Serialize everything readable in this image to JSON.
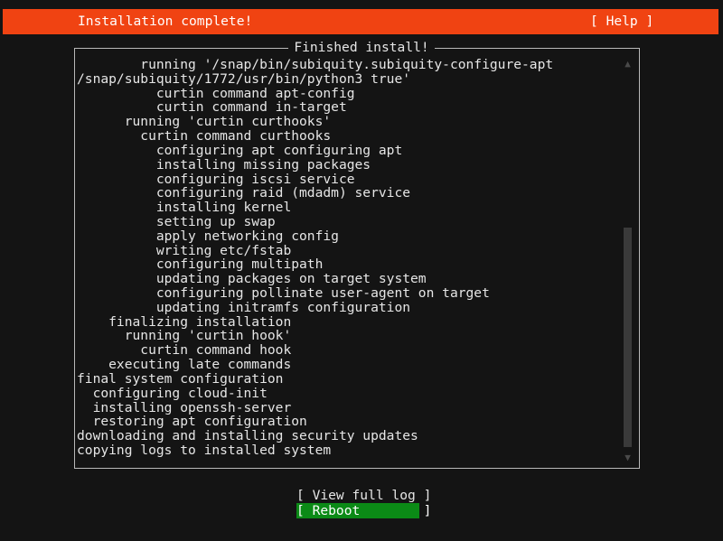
{
  "header": {
    "title": "Installation complete!",
    "help_label": "[ Help ]",
    "accent_color": "#f04312"
  },
  "panel": {
    "frame_title": "Finished install!",
    "log_lines": [
      "        running '/snap/bin/subiquity.subiquity-configure-apt",
      "/snap/subiquity/1772/usr/bin/python3 true'",
      "          curtin command apt-config",
      "          curtin command in-target",
      "      running 'curtin curthooks'",
      "        curtin command curthooks",
      "          configuring apt configuring apt",
      "          installing missing packages",
      "          configuring iscsi service",
      "          configuring raid (mdadm) service",
      "          installing kernel",
      "          setting up swap",
      "          apply networking config",
      "          writing etc/fstab",
      "          configuring multipath",
      "          updating packages on target system",
      "          configuring pollinate user-agent on target",
      "          updating initramfs configuration",
      "    finalizing installation",
      "      running 'curtin hook'",
      "        curtin command hook",
      "    executing late commands",
      "final system configuration",
      "  configuring cloud-init",
      "  installing openssh-server",
      "  restoring apt configuration",
      "downloading and installing security updates",
      "copying logs to installed system"
    ],
    "scrollbar": {
      "up_glyph": "▲",
      "down_glyph": "▼"
    }
  },
  "footer": {
    "buttons": [
      {
        "label": "[ View full log ]",
        "selected": false
      },
      {
        "label": "[ Reboot        ]",
        "selected": true
      }
    ],
    "selected_color": "#0b8a16"
  }
}
